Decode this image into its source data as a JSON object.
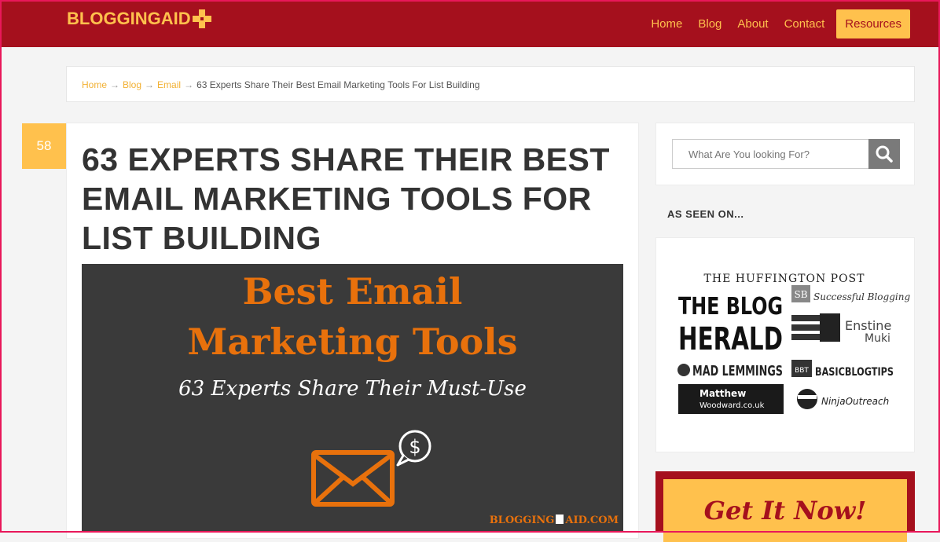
{
  "header": {
    "logo": "BLOGGINGAID",
    "nav": [
      "Home",
      "Blog",
      "About",
      "Contact"
    ],
    "resources": "Resources"
  },
  "breadcrumb": {
    "home": "Home",
    "blog": "Blog",
    "email": "Email",
    "current": "63 Experts Share Their Best Email Marketing Tools For List Building",
    "separator": "→"
  },
  "article": {
    "comment_count": "58",
    "title": "63 EXPERTS SHARE THEIR BEST EMAIL MARKETING TOOLS FOR LIST BUILDING",
    "hero": {
      "line1": "Best Email",
      "line2": "Marketing Tools",
      "subtitle": "63 Experts Share Their Must-Use",
      "brand": "BLOGGING",
      "brand2": "AID.COM"
    }
  },
  "sidebar": {
    "search_placeholder": "What Are You looking For?",
    "as_seen_on": "AS SEEN ON...",
    "press": {
      "huffington": "THE HUFFINGTON POST",
      "blog_herald_1": "THE BLOG",
      "blog_herald_2": "HERALD",
      "sb_badge": "SB",
      "successful_blogging": "Successful Blogging",
      "enstine_1": "Enstine",
      "enstine_2": "Muki",
      "mad_lemmings": "MAD LEMMINGS",
      "basic_badge": "BBT",
      "basicblogtips": "BASICBLOGTIPS",
      "matthew_1": "Matthew",
      "matthew_2": "Woodward.co.uk",
      "ninja": "NinjaOutreach"
    },
    "promo": "Get It Now!"
  },
  "colors": {
    "brand_red": "#a5101d",
    "brand_yellow": "#ffc14d",
    "hero_orange": "#e8710c",
    "hero_bg": "#3a3a3a"
  }
}
